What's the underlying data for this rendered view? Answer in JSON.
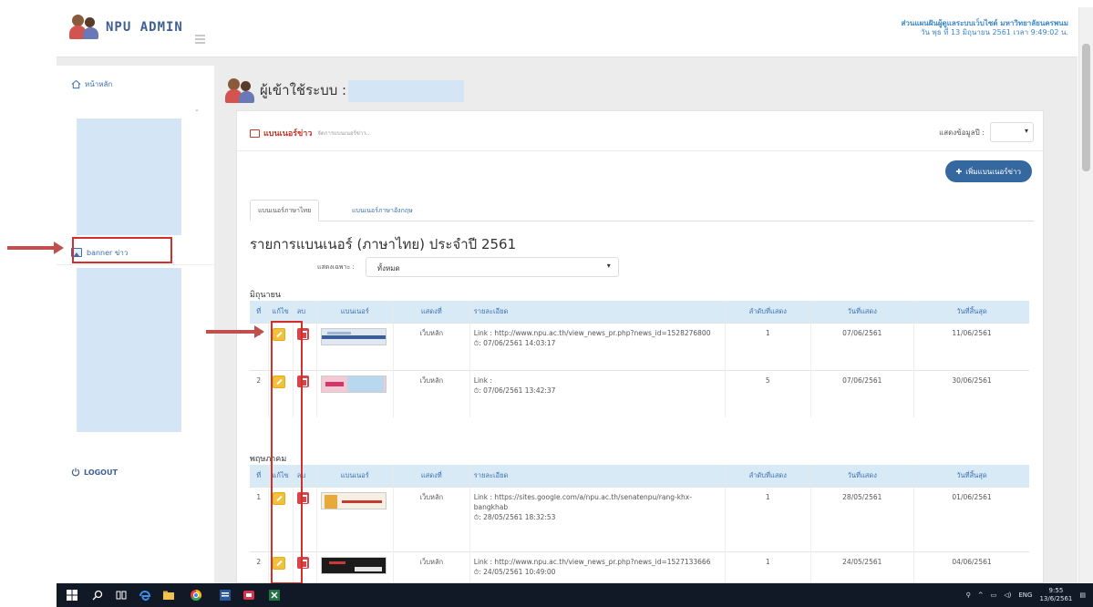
{
  "header": {
    "app_name": "NPU ADMIN",
    "org_line": "ส่วนแผนฝันผู้ดูแลระบบเว็บไซต์ มหาวิทยาลัยนครพนม",
    "date_line": "วัน พุธ ที่ 13 มิถุนายน 2561   เวลา 9:49:02   น."
  },
  "sidebar": {
    "home_label": "หน้าหลัก",
    "banner_label": "banner ข่าว",
    "logout_label": "LOGOUT"
  },
  "main": {
    "heading": "ผู้เข้าใช้ระบบ :",
    "panel_title": "แบนเนอร์ข่าว",
    "panel_subtitle": "จัดการแบนเนอร์ข่าว..",
    "show_label": "แสดงข้อมูลปี :",
    "add_button": "เพิ่มแบนเนอร์ข่าว",
    "tabs": [
      "แบนเนอร์ภาษาไทย",
      "แบนเนอร์ภาษาอังกฤษ"
    ],
    "list_title": "รายการแบนเนอร์ (ภาษาไทย) ประจำปี 2561",
    "filter_label": "แสดงเฉพาะ :",
    "filter_value": "ทั้งหมด",
    "columns": [
      "ที่",
      "แก้ไข",
      "ลบ",
      "แบนเนอร์",
      "แสดงที่",
      "รายละเอียด",
      "ลำดับที่แสดง",
      "วันที่แสดง",
      "วันที่สิ้นสุด"
    ],
    "groups": [
      {
        "month": "มิถุนายน",
        "rows": [
          {
            "no": "1",
            "show": "เว็บหลัก",
            "detail": "Link : http://www.npu.ac.th/view_news_pr.php?news_id=1528276800",
            "time": ": 07/06/2561 14:03:17",
            "order": "1",
            "start": "07/06/2561",
            "end": "11/06/2561"
          },
          {
            "no": "2",
            "show": "เว็บหลัก",
            "detail": "Link :",
            "time": ": 07/06/2561 13:42:37",
            "order": "5",
            "start": "07/06/2561",
            "end": "30/06/2561"
          }
        ]
      },
      {
        "month": "พฤษภาคม",
        "rows": [
          {
            "no": "1",
            "show": "เว็บหลัก",
            "detail": "Link : https://sites.google.com/a/npu.ac.th/senatenpu/rang-khx-bangkhab",
            "time": ": 28/05/2561 18:32:53",
            "order": "1",
            "start": "28/05/2561",
            "end": "01/06/2561"
          },
          {
            "no": "2",
            "show": "เว็บหลัก",
            "detail": "Link : http://www.npu.ac.th/view_news_pr.php?news_id=1527133666",
            "time": ": 24/05/2561 10:49:00",
            "order": "1",
            "start": "24/05/2561",
            "end": "04/06/2561"
          }
        ]
      }
    ]
  },
  "taskbar": {
    "lang": "ENG",
    "time": "9:55",
    "date": "13/6/2561"
  }
}
